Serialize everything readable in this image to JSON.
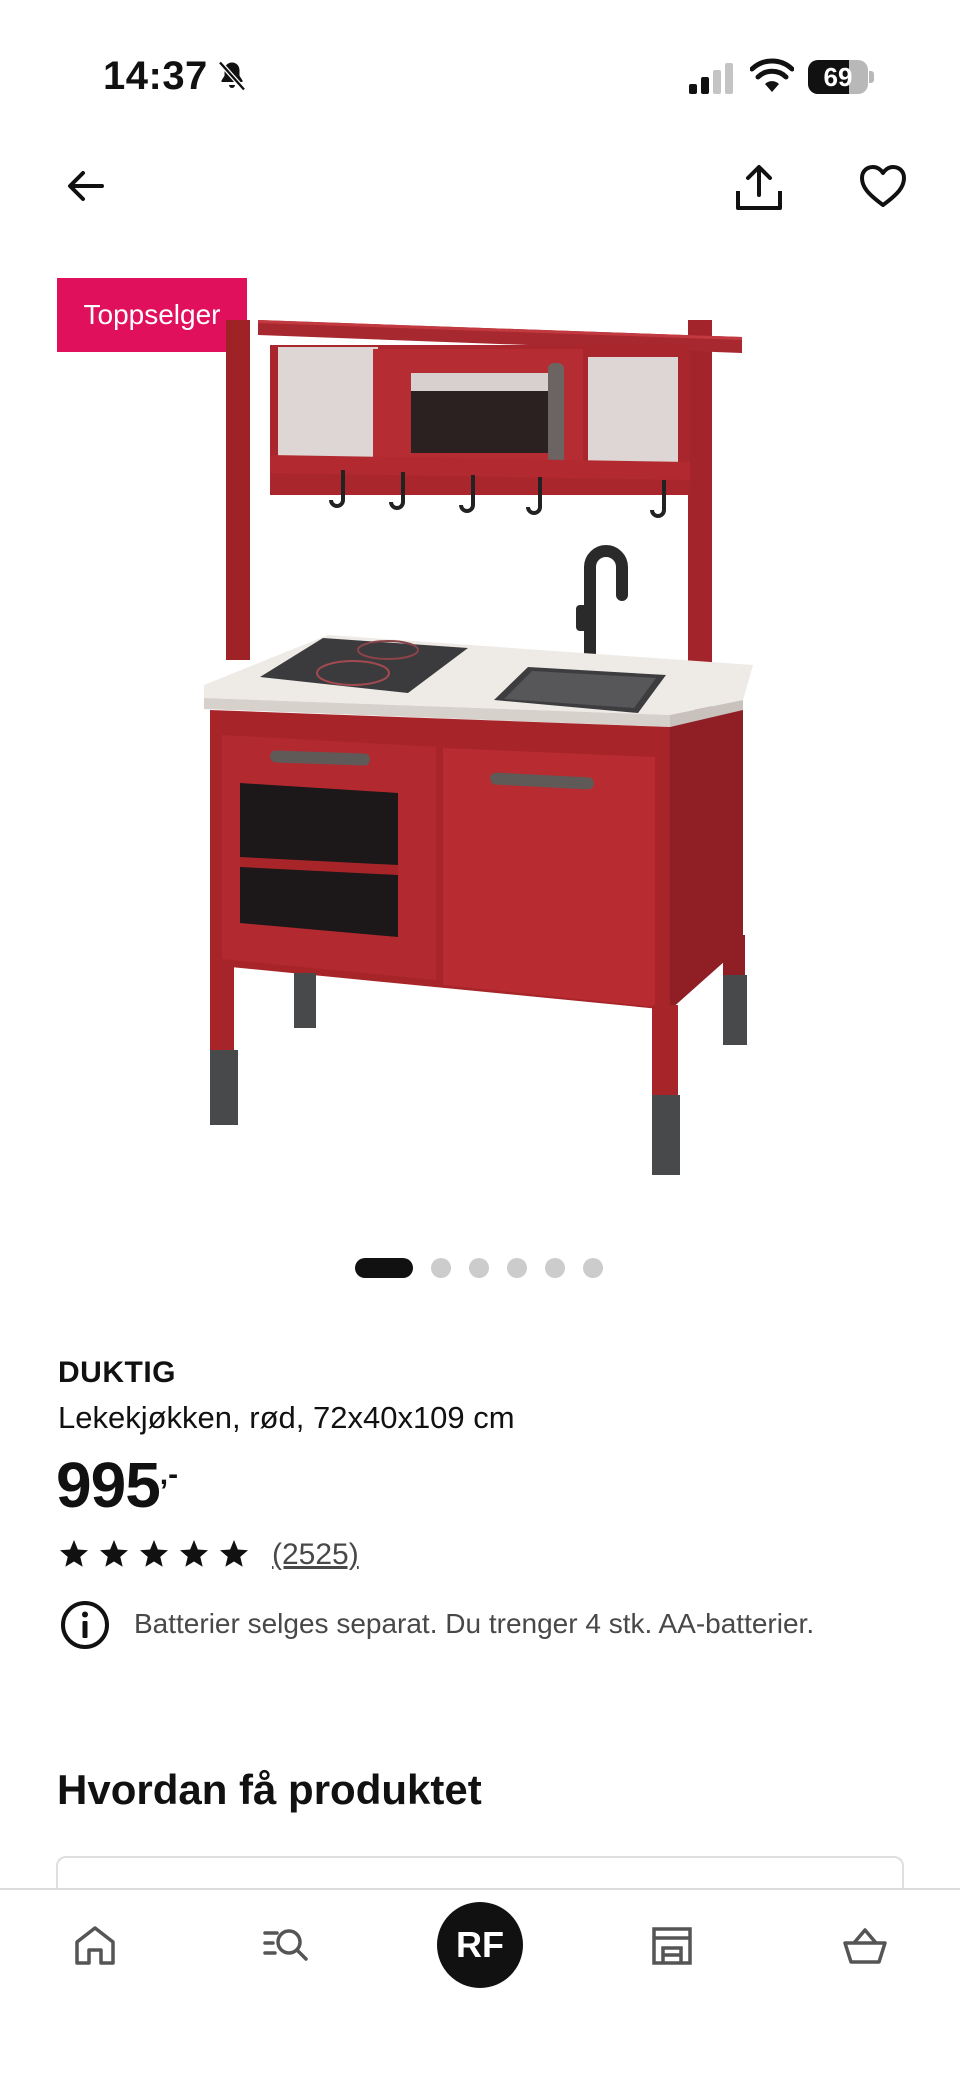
{
  "status_bar": {
    "time": "14:37",
    "battery_level": "69",
    "icons": [
      "bell-muted-icon",
      "cellular-signal-icon",
      "wifi-icon",
      "battery-icon"
    ]
  },
  "nav": {
    "icons": [
      "back-arrow-icon",
      "share-icon",
      "heart-icon"
    ]
  },
  "product": {
    "badge": "Toppselger",
    "brand": "DUKTIG",
    "description": "Lekekjøkken, rød, 72x40x109 cm",
    "price_main": "995",
    "price_suffix": ",-",
    "rating_stars": 5,
    "review_count": "(2525)",
    "info_text": "Batterier selges separat. Du trenger 4 stk. AA-batterier.",
    "image_index": 1,
    "image_count": 6
  },
  "section": {
    "title": "Hvordan få produktet"
  },
  "tab_bar": {
    "avatar_initials": "RF",
    "icons": [
      "home-icon",
      "search-list-icon",
      "avatar",
      "store-icon",
      "basket-icon"
    ]
  },
  "colors": {
    "badge": "#e0105d",
    "kitchen_red": "#b3282d",
    "text": "#111111",
    "muted": "#484848"
  }
}
